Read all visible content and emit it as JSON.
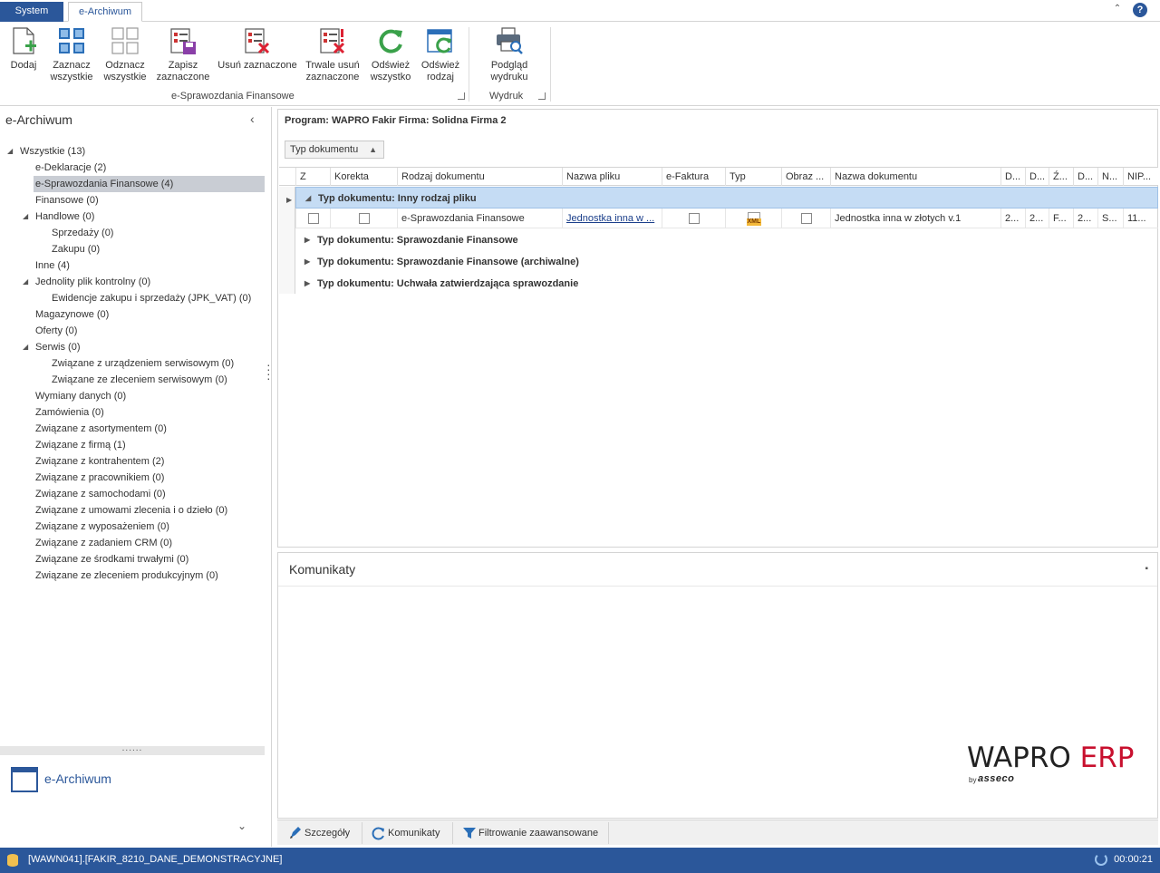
{
  "tabs": {
    "system": "System",
    "archiwum": "e-Archiwum"
  },
  "ribbon": {
    "buttons": [
      {
        "line1": "Dodaj",
        "line2": "",
        "icon": "add-document-icon"
      },
      {
        "line1": "Zaznacz",
        "line2": "wszystkie",
        "icon": "select-all-icon"
      },
      {
        "line1": "Odznacz",
        "line2": "wszystkie",
        "icon": "deselect-all-icon"
      },
      {
        "line1": "Zapisz",
        "line2": "zaznaczone",
        "icon": "save-selected-icon"
      },
      {
        "line1": "Usuń zaznaczone",
        "line2": "",
        "icon": "delete-selected-icon"
      },
      {
        "line1": "Trwale usuń",
        "line2": "zaznaczone",
        "icon": "permanent-delete-icon"
      },
      {
        "line1": "Odśwież",
        "line2": "wszystko",
        "icon": "refresh-all-icon"
      },
      {
        "line1": "Odśwież",
        "line2": "rodzaj",
        "icon": "refresh-type-icon"
      },
      {
        "line1": "Podgląd",
        "line2": "wydruku",
        "icon": "print-preview-icon"
      }
    ],
    "groups": {
      "main": "e-Sprawozdania Finansowe",
      "print": "Wydruk"
    }
  },
  "sidebar": {
    "title": "e-Archiwum",
    "tree": [
      {
        "label": "Wszystkie (13)",
        "level": 0,
        "expander": true
      },
      {
        "label": "e-Deklaracje (2)",
        "level": 1,
        "expander": false
      },
      {
        "label": "e-Sprawozdania Finansowe (4)",
        "level": 1,
        "expander": false,
        "selected": true
      },
      {
        "label": "Finansowe (0)",
        "level": 1,
        "expander": false
      },
      {
        "label": "Handlowe (0)",
        "level": 1,
        "expander": true
      },
      {
        "label": "Sprzedaży (0)",
        "level": 2,
        "expander": false
      },
      {
        "label": "Zakupu (0)",
        "level": 2,
        "expander": false
      },
      {
        "label": "Inne (4)",
        "level": 1,
        "expander": false
      },
      {
        "label": "Jednolity plik kontrolny (0)",
        "level": 1,
        "expander": true
      },
      {
        "label": "Ewidencje zakupu i sprzedaży (JPK_VAT) (0)",
        "level": 2,
        "expander": false
      },
      {
        "label": "Magazynowe (0)",
        "level": 1,
        "expander": false
      },
      {
        "label": "Oferty (0)",
        "level": 1,
        "expander": false
      },
      {
        "label": "Serwis (0)",
        "level": 1,
        "expander": true
      },
      {
        "label": "Związane z urządzeniem serwisowym (0)",
        "level": 2,
        "expander": false
      },
      {
        "label": "Związane ze zleceniem serwisowym (0)",
        "level": 2,
        "expander": false
      },
      {
        "label": "Wymiany danych (0)",
        "level": 1,
        "expander": false
      },
      {
        "label": "Zamówienia (0)",
        "level": 1,
        "expander": false
      },
      {
        "label": "Związane z asortymentem (0)",
        "level": 1,
        "expander": false
      },
      {
        "label": "Związane z firmą (1)",
        "level": 1,
        "expander": false
      },
      {
        "label": "Związane z kontrahentem (2)",
        "level": 1,
        "expander": false
      },
      {
        "label": "Związane z pracownikiem (0)",
        "level": 1,
        "expander": false
      },
      {
        "label": "Związane z samochodami (0)",
        "level": 1,
        "expander": false
      },
      {
        "label": "Związane z umowami zlecenia i o dzieło (0)",
        "level": 1,
        "expander": false
      },
      {
        "label": "Związane z wyposażeniem (0)",
        "level": 1,
        "expander": false
      },
      {
        "label": "Związane z zadaniem CRM (0)",
        "level": 1,
        "expander": false
      },
      {
        "label": "Związane ze środkami trwałymi (0)",
        "level": 1,
        "expander": false
      },
      {
        "label": "Związane ze zleceniem produkcyjnym (0)",
        "level": 1,
        "expander": false
      }
    ],
    "nav_item": "e-Archiwum"
  },
  "main": {
    "program_line": "Program: WAPRO Fakir   Firma: Solidna Firma 2",
    "group_by_chip": "Typ dokumentu",
    "columns": [
      "Z",
      "Korekta",
      "Rodzaj dokumentu",
      "Nazwa pliku",
      "e-Faktura",
      "Typ",
      "Obraz ...",
      "Nazwa dokumentu",
      "D...",
      "D...",
      "Ź...",
      "D...",
      "N...",
      "NIP..."
    ],
    "groups": [
      {
        "label": "Typ dokumentu: Inny rodzaj pliku",
        "expanded": true
      },
      {
        "label": "Typ dokumentu: Sprawozdanie Finansowe",
        "expanded": false
      },
      {
        "label": "Typ dokumentu: Sprawozdanie Finansowe (archiwalne)",
        "expanded": false
      },
      {
        "label": "Typ dokumentu: Uchwała zatwierdzająca sprawozdanie",
        "expanded": false
      }
    ],
    "row": {
      "rodzaj": "e-Sprawozdania Finansowe",
      "nazwa_pliku": "Jednostka inna w ...",
      "typ_icon": "XML",
      "nazwa_dokumentu": "Jednostka inna w złotych v.1",
      "d1": "2...",
      "d2": "2...",
      "z": "F...",
      "d3": "2...",
      "n": "S...",
      "nip": "11..."
    }
  },
  "komunikaty": {
    "title": "Komunikaty",
    "logo_main": "WAPRO",
    "logo_accent": "ERP",
    "logo_by": "by",
    "logo_asseco": "asseco"
  },
  "bottom_tabs": [
    "Szczegóły",
    "Komunikaty",
    "Filtrowanie zaawansowane"
  ],
  "status": {
    "db": "[WAWN041].[FAKIR_8210_DANE_DEMONSTRACYJNE]",
    "timer": "00:00:21"
  },
  "colors": {
    "accent": "#2b579a",
    "selection": "#c5dcf4",
    "erp_red": "#c8102e"
  }
}
